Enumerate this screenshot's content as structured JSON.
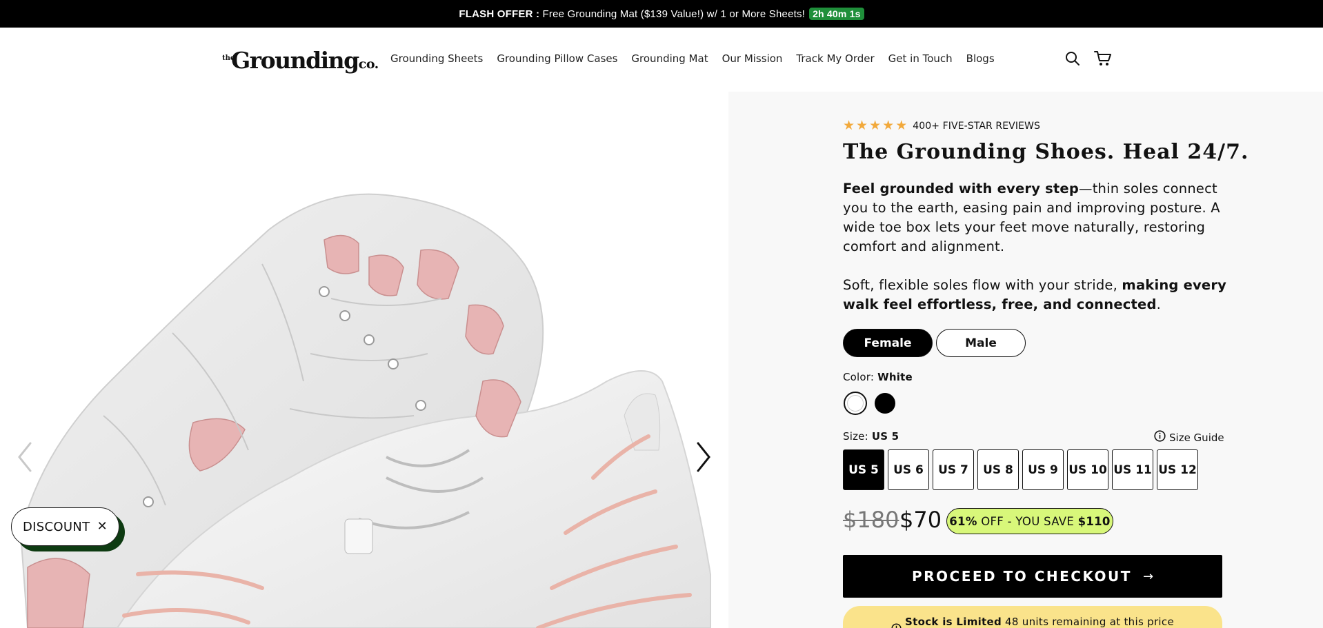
{
  "announcement": {
    "prefix": "FLASH OFFER :",
    "message": "Free Grounding Mat ($139 Value!) w/ 1 or More Sheets!",
    "timer": "2h 40m 1s"
  },
  "header": {
    "logo_the": "the",
    "logo_word": "Grounding",
    "logo_co": "co.",
    "nav": [
      "Grounding Sheets",
      "Grounding Pillow Cases",
      "Grounding Mat",
      "Our Mission",
      "Track My Order",
      "Get in Touch",
      "Blogs"
    ],
    "icons": [
      "search-icon",
      "cart-icon"
    ]
  },
  "gallery": {
    "prev_icon": "chevron-left-icon",
    "next_icon": "chevron-right-icon",
    "image": "white barefoot shoe with pink sole accents"
  },
  "discount": {
    "label": "DISCOUNT",
    "close": "✕"
  },
  "product": {
    "rating_stars": 5,
    "reviews": "400+ FIVE-STAR REVIEWS",
    "title": "The Grounding Shoes. Heal 24/7.",
    "desc1_bold": "Feel grounded with every step",
    "desc1_rest": "—thin soles connect you to the earth, easing pain and improving posture. A wide toe box lets your feet move naturally, restoring comfort and alignment.",
    "desc2_start": "Soft, flexible soles flow with your stride, ",
    "desc2_bold": "making every walk feel effortless, free, and connected",
    "desc2_end": ".",
    "genders": [
      "Female",
      "Male"
    ],
    "selected_gender": "Female",
    "color_label": "Color:",
    "color_value": "White",
    "colors": [
      "#ffffff",
      "#000000"
    ],
    "size_label": "Size:",
    "size_value": "US 5",
    "size_guide": "Size Guide",
    "sizes": [
      "US 5",
      "US 6",
      "US 7",
      "US 8",
      "US 9",
      "US 10",
      "US 11",
      "US 12"
    ],
    "price_old": "$180",
    "price_new": "$70",
    "save_percent": "61%",
    "save_text": " OFF - YOU SAVE ",
    "save_amount": "$110",
    "checkout": "PROCEED TO CHECKOUT",
    "checkout_arrow": "→",
    "stock_bold": "Stock is Limited",
    "stock_text": "48 units remaining at this price"
  },
  "colors": {
    "accent_green": "#1f8f3a",
    "badge_lime": "#d8f77a",
    "stock_yellow": "#fae38b",
    "star": "#f2a93b"
  }
}
